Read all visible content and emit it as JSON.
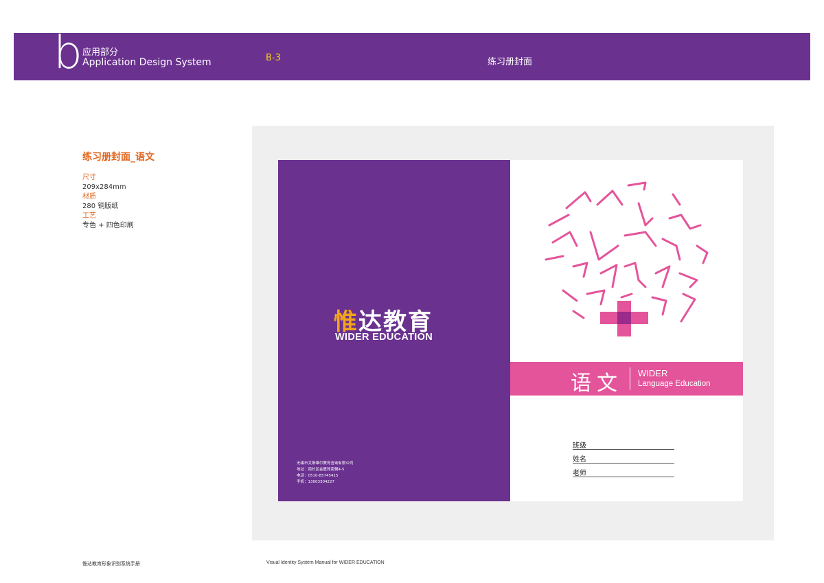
{
  "header": {
    "section_letter": "b",
    "section_cn": "应用部分",
    "section_en": "Application Design System",
    "page_code": "B-3",
    "page_title": "练习册封面"
  },
  "info": {
    "title": "练习册封面_语文",
    "size_label": "尺寸",
    "size_value": "209x284mm",
    "material_label": "材质",
    "material_value": "280 铜版纸",
    "process_label": "工艺",
    "process_value": "专色 + 四色印刷"
  },
  "cover": {
    "logo_cn_a": "惟",
    "logo_cn_b": "达教育",
    "logo_en": "WIDER EDUCATION",
    "contact": [
      "无锡市艾斯维尔教育咨询有限公司",
      "地址：南长区金匮苑南辅4-5",
      "电话：0510-85745415",
      "手机：13003304227"
    ],
    "subject": "语文",
    "brand_line1": "WIDER",
    "brand_line2": "Language Education",
    "fields": [
      "班级",
      "姓名",
      "老师"
    ]
  },
  "footer": {
    "left": "惟达教育形象识别系统手册",
    "right": "Visual Identity System Manual for WIDER EDUCATION"
  },
  "colors": {
    "purple": "#6a318f",
    "pink": "#e4549a",
    "orange": "#e2651d",
    "yellow": "#f2d21b"
  }
}
